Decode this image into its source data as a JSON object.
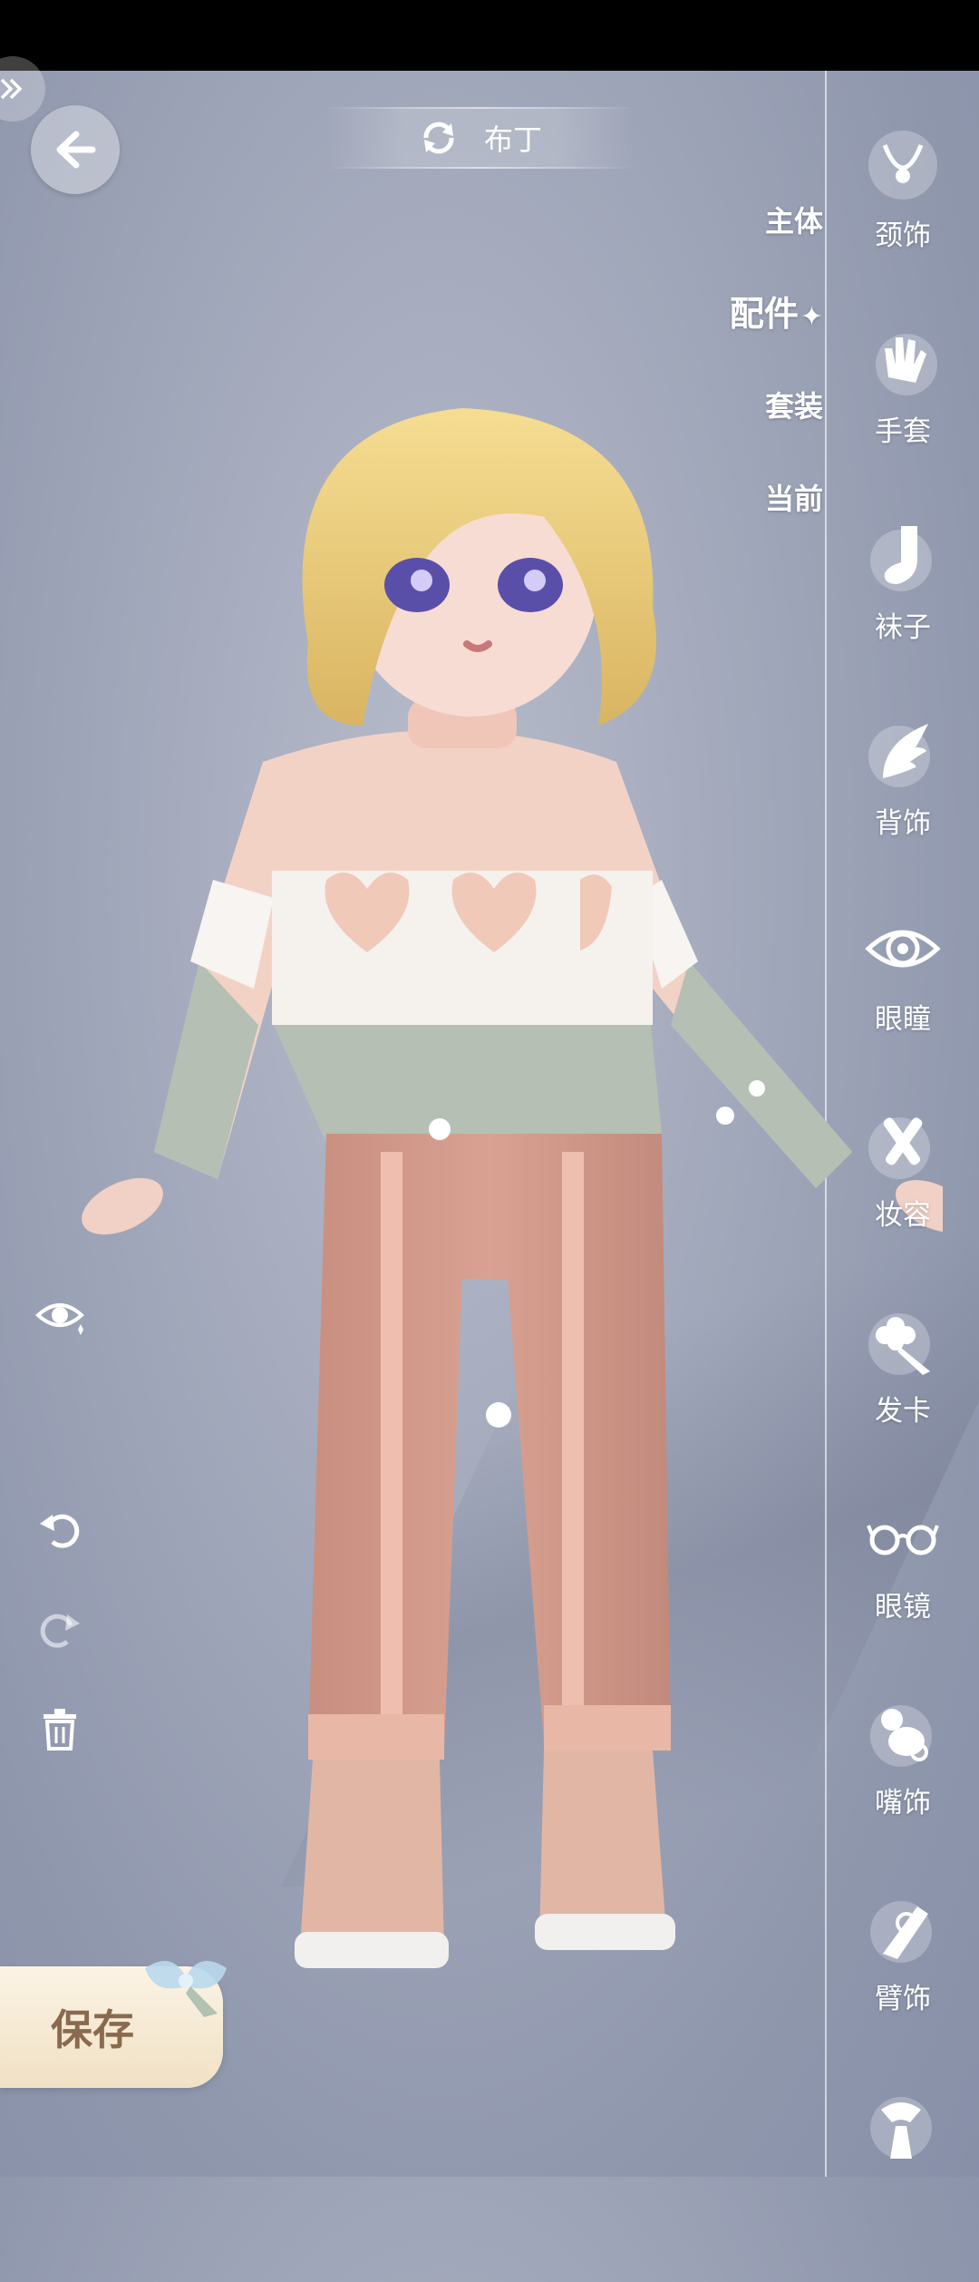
{
  "header": {
    "title": "布丁"
  },
  "tabs": [
    {
      "label": "主体",
      "active": false
    },
    {
      "label": "配件",
      "active": true
    },
    {
      "label": "套装",
      "active": false
    },
    {
      "label": "当前",
      "active": false
    }
  ],
  "categories": [
    {
      "label": "颈饰",
      "icon": "necklace-icon"
    },
    {
      "label": "手套",
      "icon": "glove-icon"
    },
    {
      "label": "袜子",
      "icon": "sock-icon"
    },
    {
      "label": "背饰",
      "icon": "wing-icon"
    },
    {
      "label": "眼瞳",
      "icon": "eye-icon"
    },
    {
      "label": "妆容",
      "icon": "makeup-brush-icon"
    },
    {
      "label": "发卡",
      "icon": "hairclip-icon"
    },
    {
      "label": "眼镜",
      "icon": "glasses-icon"
    },
    {
      "label": "嘴饰",
      "icon": "pacifier-icon"
    },
    {
      "label": "臂饰",
      "icon": "arm-ornament-icon"
    }
  ],
  "save": {
    "label": "保存"
  },
  "colors": {
    "background": "#a5abbd",
    "accent": "#ffffff",
    "save_text": "#8a6a4e"
  }
}
